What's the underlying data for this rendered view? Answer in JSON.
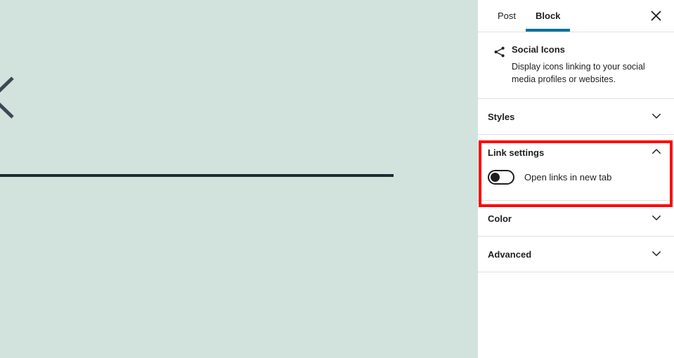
{
  "canvas": {
    "background_color": "#d2e2dc",
    "decorations": [
      {
        "name": "chevron-left-glyph",
        "shape": "chevron-left"
      },
      {
        "name": "horizontal-rule",
        "color": "#1e2b33"
      }
    ]
  },
  "sidebar": {
    "tabs": [
      {
        "label": "Post",
        "active": false
      },
      {
        "label": "Block",
        "active": true
      }
    ],
    "active_tab_color": "#0071a1",
    "close_label": "Close settings",
    "block": {
      "icon": "share-icon",
      "title": "Social Icons",
      "description": "Display icons linking to your social media profiles or websites."
    },
    "panels": [
      {
        "title": "Styles",
        "expanded": false,
        "chevron": "chevron-down-icon"
      },
      {
        "title": "Link settings",
        "expanded": true,
        "chevron": "chevron-up-icon"
      },
      {
        "title": "Color",
        "expanded": false,
        "chevron": "chevron-down-icon"
      },
      {
        "title": "Advanced",
        "expanded": false,
        "chevron": "chevron-down-icon"
      }
    ],
    "link_settings": {
      "toggle_label": "Open links in new tab",
      "toggle_on": false
    }
  },
  "annotation": {
    "highlight_color": "#ff0000",
    "target": "Link settings"
  }
}
